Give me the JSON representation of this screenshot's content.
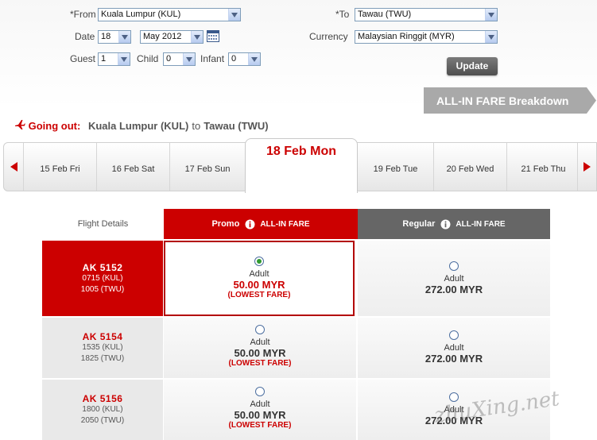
{
  "form": {
    "from_label": "*From",
    "from_value": "Kuala Lumpur (KUL)",
    "to_label": "*To",
    "to_value": "Tawau (TWU)",
    "date_label": "Date",
    "date_day": "18",
    "date_month": "May 2012",
    "currency_label": "Currency",
    "currency_value": "Malaysian Ringgit (MYR)",
    "guest_label": "Guest",
    "guest_value": "1",
    "child_label": "Child",
    "child_value": "0",
    "infant_label": "Infant",
    "infant_value": "0",
    "update_label": "Update"
  },
  "breakdown_label": "ALL-IN FARE Breakdown",
  "going_out": {
    "label": "Going out:",
    "origin": "Kuala Lumpur (KUL)",
    "to": "to",
    "destination": "Tawau (TWU)"
  },
  "dates": {
    "before": [
      "15 Feb Fri",
      "16 Feb Sat",
      "17 Feb Sun"
    ],
    "selected": "18 Feb Mon",
    "after": [
      "19 Feb Tue",
      "20 Feb Wed",
      "21 Feb Thu"
    ]
  },
  "table": {
    "details_header": "Flight Details",
    "promo_header": "Promo",
    "regular_header": "Regular",
    "allin_label": "ALL-IN FARE",
    "rows": [
      {
        "flight": "AK  5152",
        "depart": "0715  (KUL)",
        "arrive": "1005  (TWU)",
        "promo_pax": "Adult",
        "promo_price": "50.00 MYR",
        "promo_note": "(LOWEST FARE)",
        "regular_pax": "Adult",
        "regular_price": "272.00 MYR"
      },
      {
        "flight": "AK  5154",
        "depart": "1535  (KUL)",
        "arrive": "1825  (TWU)",
        "promo_pax": "Adult",
        "promo_price": "50.00 MYR",
        "promo_note": "(LOWEST FARE)",
        "regular_pax": "Adult",
        "regular_price": "272.00 MYR"
      },
      {
        "flight": "AK  5156",
        "depart": "1800  (KUL)",
        "arrive": "2050  (TWU)",
        "promo_pax": "Adult",
        "promo_price": "50.00 MYR",
        "promo_note": "(LOWEST FARE)",
        "regular_pax": "Adult",
        "regular_price": "272.00 MYR"
      }
    ]
  },
  "watermark": "zhuXing.net",
  "colors": {
    "brand_red": "#cc0000",
    "regular_gray": "#666666",
    "breakdown_gray": "#a8a8a8"
  }
}
